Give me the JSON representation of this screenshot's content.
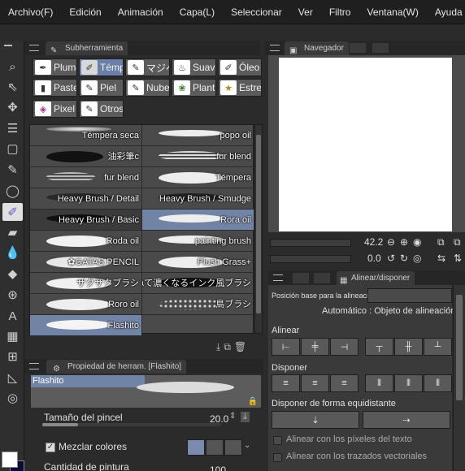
{
  "menu": [
    "Archivo(F)",
    "Edición",
    "Animación",
    "Capa(L)",
    "Seleccionar",
    "Ver",
    "Filtro",
    "Ventana(W)",
    "Ayuda"
  ],
  "sub_tool_panel": {
    "tab_label": "Subherramienta",
    "groups": [
      {
        "label": "Pluma",
        "icon": "pen-icon",
        "selected": false
      },
      {
        "label": "Témpera",
        "icon": "brush-icon",
        "selected": true
      },
      {
        "label": "マジペ",
        "icon": "marker-icon",
        "selected": false
      },
      {
        "label": "Suave",
        "icon": "soft-brush-icon",
        "selected": false
      },
      {
        "label": "Óleo",
        "icon": "oil-icon",
        "selected": false
      },
      {
        "label": "Pastel",
        "icon": "pastel-icon",
        "selected": false
      },
      {
        "label": "Piel",
        "icon": "skin-icon",
        "selected": false
      },
      {
        "label": "Nubes",
        "icon": "cloud-brush-icon",
        "selected": false
      },
      {
        "label": "Plantas",
        "icon": "plant-icon",
        "selected": false
      },
      {
        "label": "Estrellas",
        "icon": "star-brush-icon",
        "selected": false
      },
      {
        "label": "Pixel",
        "icon": "pixel-icon",
        "selected": false
      },
      {
        "label": "Otros",
        "icon": "misc-icon",
        "selected": false
      }
    ],
    "brushes": [
      {
        "label": "Témpera seca",
        "selected": false
      },
      {
        "label": "popo oil",
        "selected": false
      },
      {
        "label": "油彩筆c",
        "selected": false
      },
      {
        "label": "fur blend",
        "selected": false
      },
      {
        "label": "fur blend",
        "selected": false
      },
      {
        "label": "Témpera",
        "selected": false
      },
      {
        "label": "Heavy Brush / Detail",
        "selected": false
      },
      {
        "label": "Heavy Brush / Smudge",
        "selected": false
      },
      {
        "label": "Heavy Brush / Basic",
        "selected": false
      },
      {
        "label": "Rora oil",
        "selected": false
      },
      {
        "label": "Roda oil",
        "selected": false
      },
      {
        "label": "painting brush",
        "selected": false
      },
      {
        "label": "✿GATAS PENCIL",
        "selected": false
      },
      {
        "label": "Plush Grass+",
        "selected": false
      },
      {
        "label": "ザクザクブラシ",
        "selected": false
      },
      {
        "label": "重ねて濃くなるインク風ブラシ",
        "selected": false
      },
      {
        "label": "Roro oil",
        "selected": false
      },
      {
        "label": "鳥ブラシ",
        "selected": false
      },
      {
        "label": "Flashito",
        "selected": true
      }
    ]
  },
  "tool_property": {
    "tab_label": "Propiedad de herram. [Flashito]",
    "preview_title": "Flashito",
    "brush_size_label": "Tamaño del pincel",
    "brush_size_value": "20.0",
    "brush_size_fraction": 0.2,
    "mix_colors_label": "Mezclar colores",
    "mix_colors_checked": true,
    "paint_amount_label": "Cantidad de pintura",
    "paint_amount_value": "100"
  },
  "navigator": {
    "tab_label": "Navegador",
    "zoom_value": "42.2",
    "rotation_value": "0.0"
  },
  "align_panel": {
    "tab_label": "Alinear/disponer",
    "base_position_label": "Posición base para la alineación",
    "auto_target_label": "Automático : Objeto de alineación",
    "align_label": "Alinear",
    "arrange_label": "Disponer",
    "equidistant_label": "Disponer de forma equidistante",
    "pixels_text_label": "Alinear con los píxeles del texto",
    "vector_paths_label": "Alinear con los trazados vectoriales"
  },
  "colors": {
    "selection": "#7284a6",
    "main_color": "#ffffff",
    "sub_color": "#0b0b3a"
  }
}
